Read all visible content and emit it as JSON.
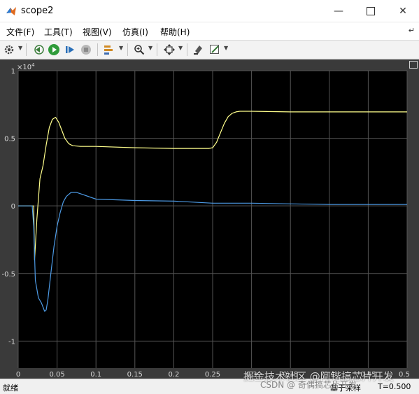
{
  "window": {
    "title": "scope2"
  },
  "menu": {
    "items": [
      "文件(F)",
      "工具(T)",
      "视图(V)",
      "仿真(I)",
      "帮助(H)"
    ],
    "overflow_icon": "chevron-right-icon"
  },
  "toolbar": {
    "icons": [
      "gear-icon",
      "stop-step-back-icon",
      "run-icon",
      "step-forward-icon",
      "stop-icon",
      "triggers-icon",
      "zoom-in-icon",
      "fit-to-view-icon",
      "highlight-icon",
      "edit-style-icon"
    ]
  },
  "colors": {
    "plot_background": "#000000",
    "frame_background": "#3a3a3a",
    "grid": "#555555",
    "axis_text": "#d9d9d9",
    "series_yellow": "#ffff8c",
    "series_blue": "#4d9be6"
  },
  "chart_data": {
    "type": "line",
    "x_ticks": [
      "0",
      "0.05",
      "0.1",
      "0.15",
      "0.2",
      "0.25",
      "0.3",
      "0.35",
      "0.4",
      "0.45",
      "0.5"
    ],
    "y_ticks": [
      "-1",
      "-0.5",
      "0",
      "0.5",
      "1"
    ],
    "y_exponent": "×10",
    "y_exponent_power": "4",
    "xlim": [
      0,
      0.5
    ],
    "ylim": [
      -1.2,
      1.0
    ],
    "grid": true,
    "series": [
      {
        "color": "#ffff8c",
        "x": [
          0,
          0.02,
          0.021,
          0.024,
          0.028,
          0.032,
          0.036,
          0.04,
          0.044,
          0.048,
          0.052,
          0.056,
          0.06,
          0.065,
          0.07,
          0.08,
          0.1,
          0.15,
          0.2,
          0.245,
          0.25,
          0.255,
          0.26,
          0.265,
          0.27,
          0.275,
          0.28,
          0.285,
          0.3,
          0.35,
          0.4,
          0.45,
          0.5
        ],
        "y": [
          0,
          0,
          -0.4,
          -0.1,
          0.2,
          0.3,
          0.45,
          0.58,
          0.64,
          0.655,
          0.62,
          0.56,
          0.5,
          0.46,
          0.445,
          0.44,
          0.44,
          0.43,
          0.425,
          0.425,
          0.43,
          0.47,
          0.54,
          0.61,
          0.66,
          0.685,
          0.695,
          0.7,
          0.7,
          0.695,
          0.695,
          0.695,
          0.695
        ]
      },
      {
        "color": "#4d9be6",
        "x": [
          0,
          0.018,
          0.02,
          0.022,
          0.026,
          0.03,
          0.034,
          0.036,
          0.038,
          0.042,
          0.046,
          0.05,
          0.054,
          0.058,
          0.062,
          0.068,
          0.075,
          0.085,
          0.1,
          0.15,
          0.2,
          0.25,
          0.3,
          0.35,
          0.4,
          0.45,
          0.5
        ],
        "y": [
          0,
          0,
          -0.15,
          -0.55,
          -0.68,
          -0.72,
          -0.78,
          -0.77,
          -0.7,
          -0.5,
          -0.3,
          -0.15,
          -0.05,
          0.03,
          0.07,
          0.1,
          0.1,
          0.08,
          0.05,
          0.04,
          0.035,
          0.02,
          0.02,
          0.015,
          0.01,
          0.01,
          0.01
        ]
      }
    ]
  },
  "status": {
    "left": "就绪",
    "mid": "基于采样",
    "right": "T=0.500"
  },
  "watermark": {
    "main": "掘金技术社区 @阿锴搞芯片开发",
    "sub": "CSDN @ 奇偶搞芯片开发"
  }
}
